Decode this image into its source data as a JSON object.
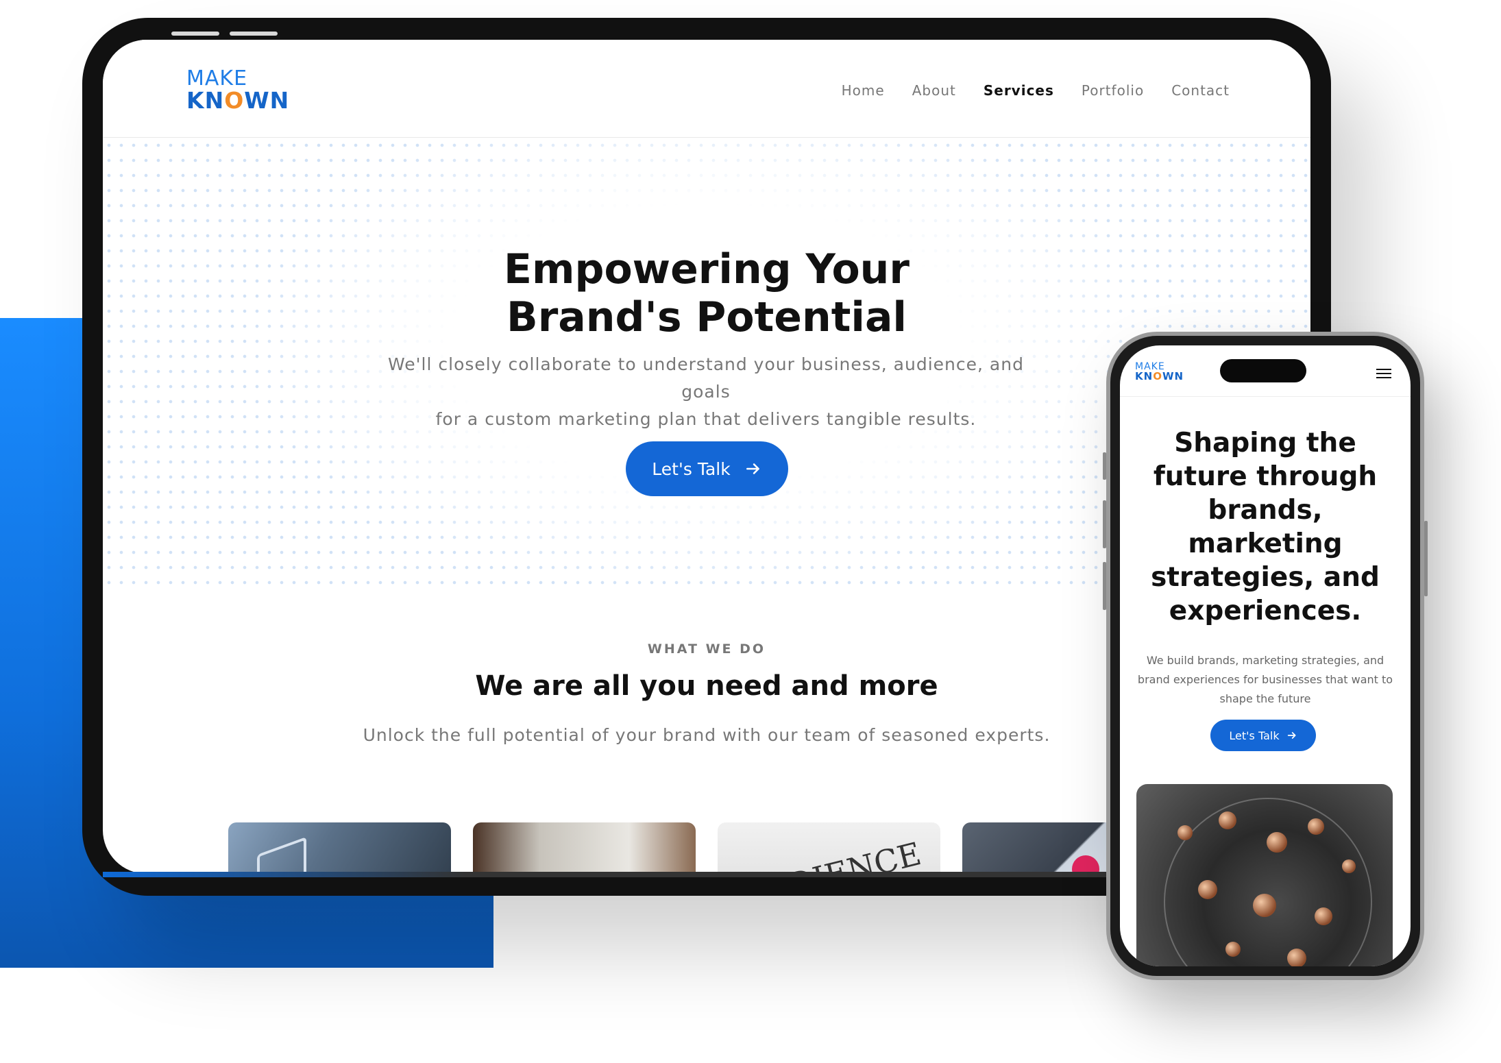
{
  "colors": {
    "accent": "#1467d6",
    "brand_blue": "#1f7de6",
    "brand_orange": "#f28c28",
    "panel_blue": "#1a8cff"
  },
  "logo": {
    "line1": "MAKE",
    "line2_a": "KN",
    "line2_o": "O",
    "line2_b": "WN"
  },
  "tablet": {
    "nav": [
      {
        "label": "Home",
        "active": false
      },
      {
        "label": "About",
        "active": false
      },
      {
        "label": "Services",
        "active": true
      },
      {
        "label": "Portfolio",
        "active": false
      },
      {
        "label": "Contact",
        "active": false
      }
    ],
    "hero": {
      "title_line1": "Empowering Your",
      "title_line2": "Brand's Potential",
      "subtitle_line1": "We'll closely collaborate to understand your business, audience, and goals",
      "subtitle_line2": "for a custom marketing plan that delivers tangible results.",
      "cta_label": "Let's Talk",
      "cta_icon": "arrow-right-icon"
    },
    "services": {
      "eyebrow": "WHAT WE DO",
      "heading": "We are all you need and more",
      "lead": "Unlock the full potential of your brand with our team of seasoned experts.",
      "cards": [
        {
          "image": "laptop-desk-photo"
        },
        {
          "image": "whiteboard-meeting-photo"
        },
        {
          "image": "audience-sketch-photo",
          "text": "AUDIENCE"
        },
        {
          "image": "social-apps-phone-photo"
        }
      ]
    }
  },
  "phone": {
    "menu_icon": "hamburger-menu-icon",
    "hero": {
      "title": "Shaping the future through brands, marketing strategies, and experiences.",
      "subtitle": "We build brands, marketing strategies, and brand experiences for businesses that want to shape the future",
      "cta_label": "Let's Talk",
      "cta_icon": "arrow-right-icon"
    },
    "image": "abstract-sphere-render"
  }
}
